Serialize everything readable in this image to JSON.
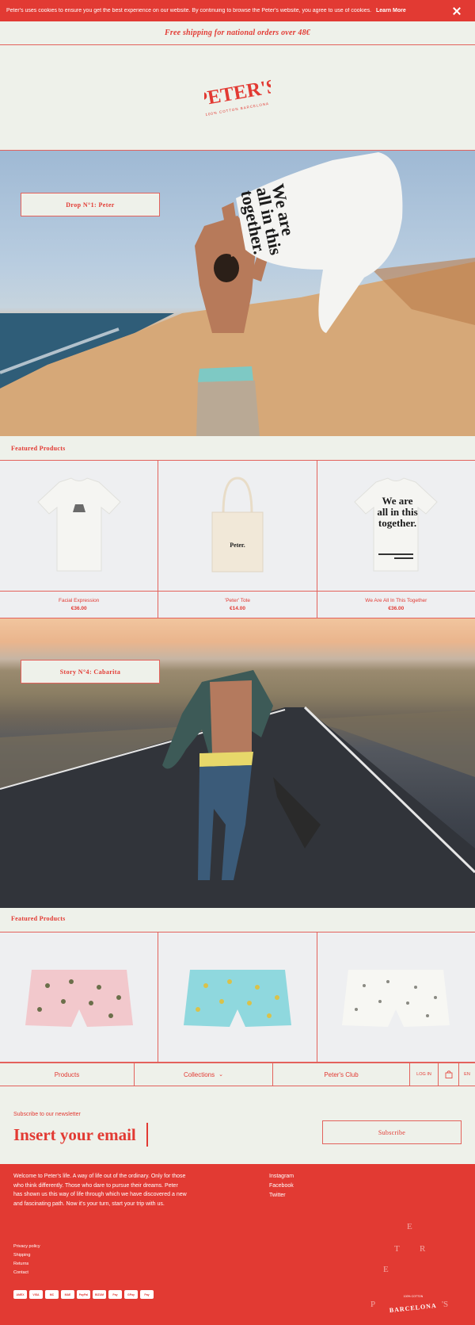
{
  "cookie": {
    "text": "Peter's uses cookies to ensure you get the best experience on our website. By continuing to browse the Peter's website, you agree to use of cookies.",
    "link": "Learn More"
  },
  "shipping": "Free shipping for national orders over 48€",
  "logo": {
    "name": "PETER'S",
    "sub": "100% COTTON BARCELONA"
  },
  "hero1": {
    "tag": "Drop N°1: Peter",
    "shirt_print": [
      "We are",
      "all in this",
      "together."
    ]
  },
  "featured1": {
    "label": "Featured Products",
    "products": [
      {
        "name": "Facial Expression",
        "price": "€36.00"
      },
      {
        "name": "'Peter' Tote",
        "price": "€14.00",
        "print": "Peter."
      },
      {
        "name": "We Are All In This Together",
        "price": "€36.00",
        "print": [
          "We are",
          "all in this",
          "together."
        ]
      }
    ]
  },
  "hero2": {
    "tag": "Story N°4: Cabarita"
  },
  "featured2": {
    "label": "Featured Products"
  },
  "nav": {
    "products": "Products",
    "collections": "Collections",
    "club": "Peter's Club",
    "login": "LOG IN",
    "lang": "EN"
  },
  "newsletter": {
    "label": "Subscribe to our newsletter",
    "placeholder": "Insert your email",
    "button": "Subscribe"
  },
  "footer": {
    "about": "Welcome to Peter's life. A way of life out of the ordinary. Only for those who think differently. Those who dare to pursue their dreams. Peter has shown us this way of life through which we have discovered a new and fascinating path. Now it's your turn, start your trip with us.",
    "social": [
      "Instagram",
      "Facebook",
      "Twitter"
    ],
    "links": [
      "Privacy policy",
      "Shipping",
      "Returns",
      "Contact"
    ],
    "payments": [
      "AMEX",
      "VISA",
      "MC",
      "MAE",
      "PayPal",
      "BIZUM",
      "Pay",
      "GPay",
      "Pay"
    ],
    "badge": {
      "letters": [
        "P",
        "E",
        "T",
        "E",
        "R",
        "'S"
      ],
      "city": "BARCELONA",
      "sub": "100% COTTON"
    }
  },
  "colors": {
    "accent": "#E23A33",
    "background": "#EEF1EA"
  }
}
